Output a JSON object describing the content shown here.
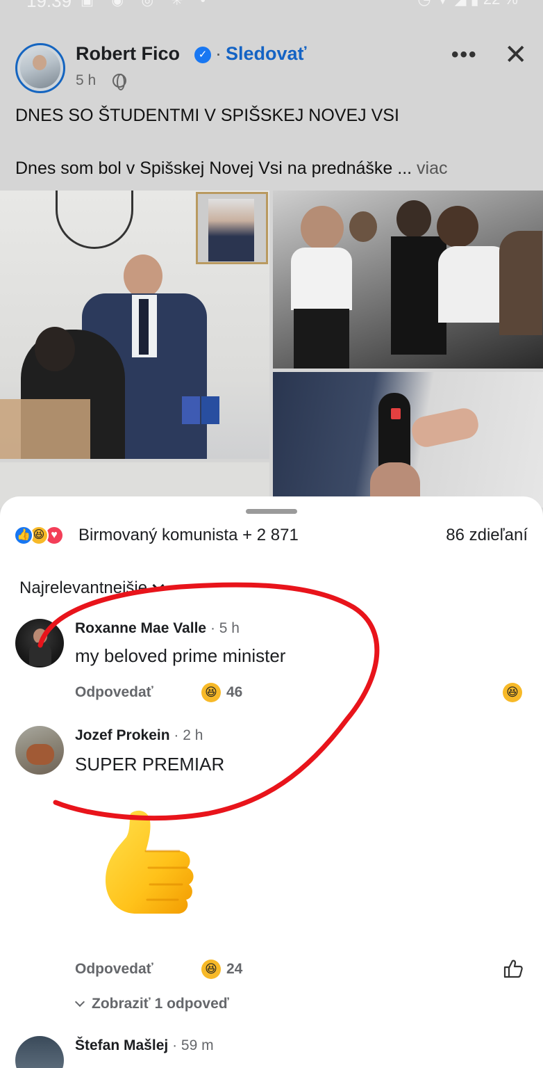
{
  "status_bar": {
    "time": "19:39",
    "battery": "22 %"
  },
  "post": {
    "author": "Robert Fico",
    "follow_label": "Sledovať",
    "time": "5 h",
    "title": "DNES SO ŠTUDENTMI V SPIŠSKEJ NOVEJ VSI",
    "body": "Dnes som bol v Spišskej Novej Vsi na prednáške ...",
    "more_label": "viac"
  },
  "reactions": {
    "summary": "Birmovaný komunista + 2 871",
    "shares": "86 zdieľaní",
    "types": [
      "like-icon",
      "haha-icon",
      "love-icon"
    ]
  },
  "sort": {
    "label": "Najrelevantnejšie"
  },
  "comments": [
    {
      "author": "Roxanne Mae Valle",
      "time": "5 h",
      "text": "my beloved prime minister",
      "reply_label": "Odpovedať",
      "reaction_count": "46"
    },
    {
      "author": "Jozef Prokein",
      "time": "2 h",
      "text": "SUPER PREMIAR",
      "reply_label": "Odpovedať",
      "reaction_count": "24",
      "view_replies": "Zobraziť 1 odpoveď"
    },
    {
      "author": "Štefan Mašlej",
      "time": "59 m"
    }
  ],
  "colors": {
    "link_blue": "#1463c4",
    "verified_blue": "#1877f2",
    "scribble_red": "#e8141b",
    "haha_yellow": "#f7b928"
  }
}
